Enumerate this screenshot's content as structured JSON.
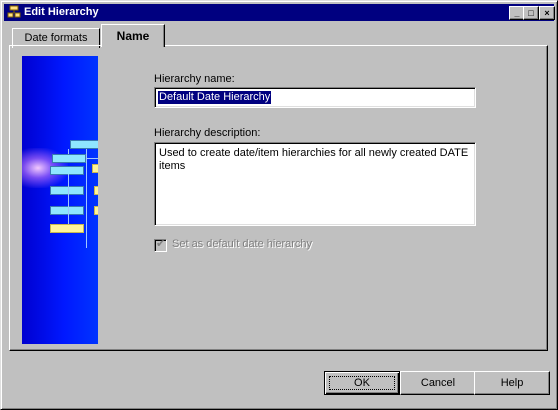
{
  "window": {
    "title": "Edit Hierarchy",
    "controls": {
      "minimize": "_",
      "maximize": "□",
      "close": "×"
    }
  },
  "tabs": [
    {
      "label": "Date formats",
      "active": false
    },
    {
      "label": "Name",
      "active": true
    }
  ],
  "form": {
    "name_label": "Hierarchy name:",
    "name_value": "Default Date Hierarchy",
    "description_label": "Hierarchy description:",
    "description_value": "Used to create date/item hierarchies for all newly created DATE items",
    "default_checkbox_label": "Set as default date hierarchy",
    "default_checkbox_checked": true,
    "default_checkbox_enabled": false
  },
  "buttons": {
    "ok": "OK",
    "cancel": "Cancel",
    "help": "Help"
  },
  "icons": {
    "title": "hierarchy-app-icon",
    "illustration": "hierarchy-diagram-illustration",
    "check": "checkmark-icon"
  },
  "colors": {
    "titlebar": "#000080",
    "illustration_blue": "#0018ff",
    "selection": "#000080"
  }
}
